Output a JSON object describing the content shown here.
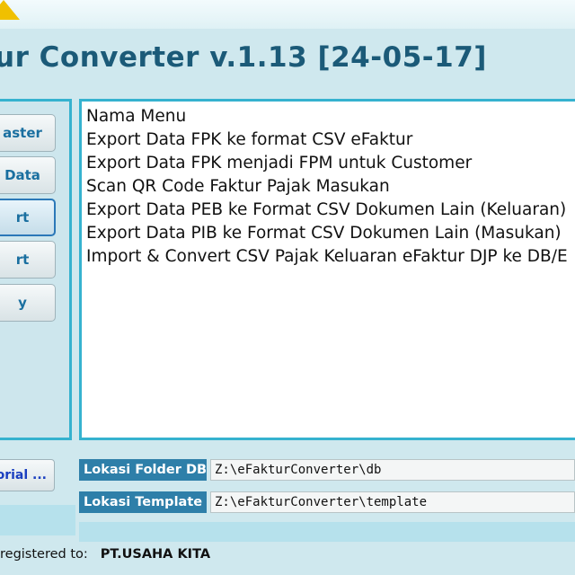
{
  "app": {
    "title": "ur Converter v.1.13 [24-05-17]"
  },
  "sidebar": {
    "buttons": [
      {
        "label": "aster"
      },
      {
        "label": "Data"
      },
      {
        "label": "rt"
      },
      {
        "label": "rt"
      },
      {
        "label": "y"
      }
    ]
  },
  "menu": {
    "header": "Nama Menu",
    "items": [
      "Export Data FPK ke format CSV eFaktur",
      "Export Data FPK menjadi FPM untuk Customer",
      "Scan QR Code Faktur Pajak Masukan",
      "Export Data PEB ke Format CSV Dokumen Lain (Keluaran)",
      "Export Data PIB ke Format CSV Dokumen Lain (Masukan)",
      "Import & Convert CSV Pajak Keluaran eFaktur DJP ke DB/E"
    ]
  },
  "tutorial_button": {
    "label": "orial ..."
  },
  "locations": {
    "db": {
      "label": "Lokasi Folder DB",
      "value": "Z:\\eFakturConverter\\db"
    },
    "template": {
      "label": "Lokasi Template",
      "value": "Z:\\eFakturConverter\\template"
    }
  },
  "registration": {
    "prefix": "registered to:",
    "company": "PT.USAHA KITA"
  }
}
